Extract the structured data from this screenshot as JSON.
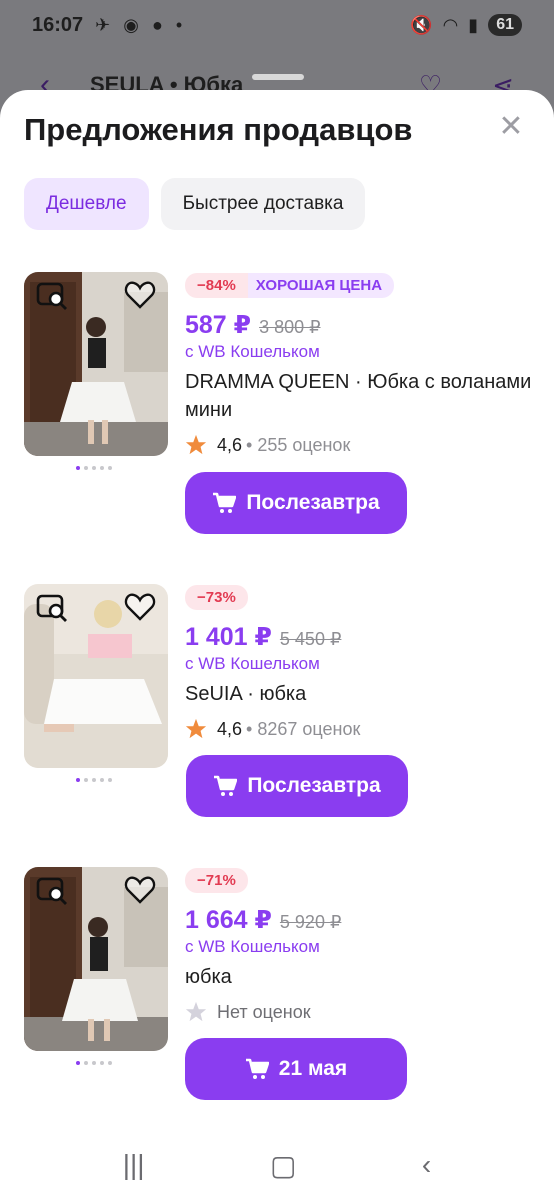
{
  "status_bar": {
    "time": "16:07",
    "battery": "61"
  },
  "background": {
    "title": "SEULA • Юбка"
  },
  "sheet": {
    "title": "Предложения продавцов",
    "filters": [
      "Дешевле",
      "Быстрее доставка"
    ]
  },
  "offers": [
    {
      "discount": "−84%",
      "tag": "ХОРОШАЯ ЦЕНА",
      "price": "587 ₽",
      "old_price": "3 800 ₽",
      "wallet": "с WB Кошельком",
      "name": "DRAMMA QUEEN · Юбка с воланами мини",
      "rating": "4,6",
      "reviews": "• 255 оценок",
      "button": "Послезавтра"
    },
    {
      "discount": "−73%",
      "price": "1 401 ₽",
      "old_price": "5 450 ₽",
      "wallet": "с WB Кошельком",
      "name": "SeUIA · юбка",
      "rating": "4,6",
      "reviews": "• 8267 оценок",
      "button": "Послезавтра"
    },
    {
      "discount": "−71%",
      "price": "1 664 ₽",
      "old_price": "5 920 ₽",
      "wallet": "с WB Кошельком",
      "name": "юбка",
      "no_rating": "Нет оценок",
      "button": "21 мая"
    }
  ],
  "colors": {
    "accent": "#8a3df0",
    "discount": "#e23b52",
    "star": "#f08b3c"
  }
}
